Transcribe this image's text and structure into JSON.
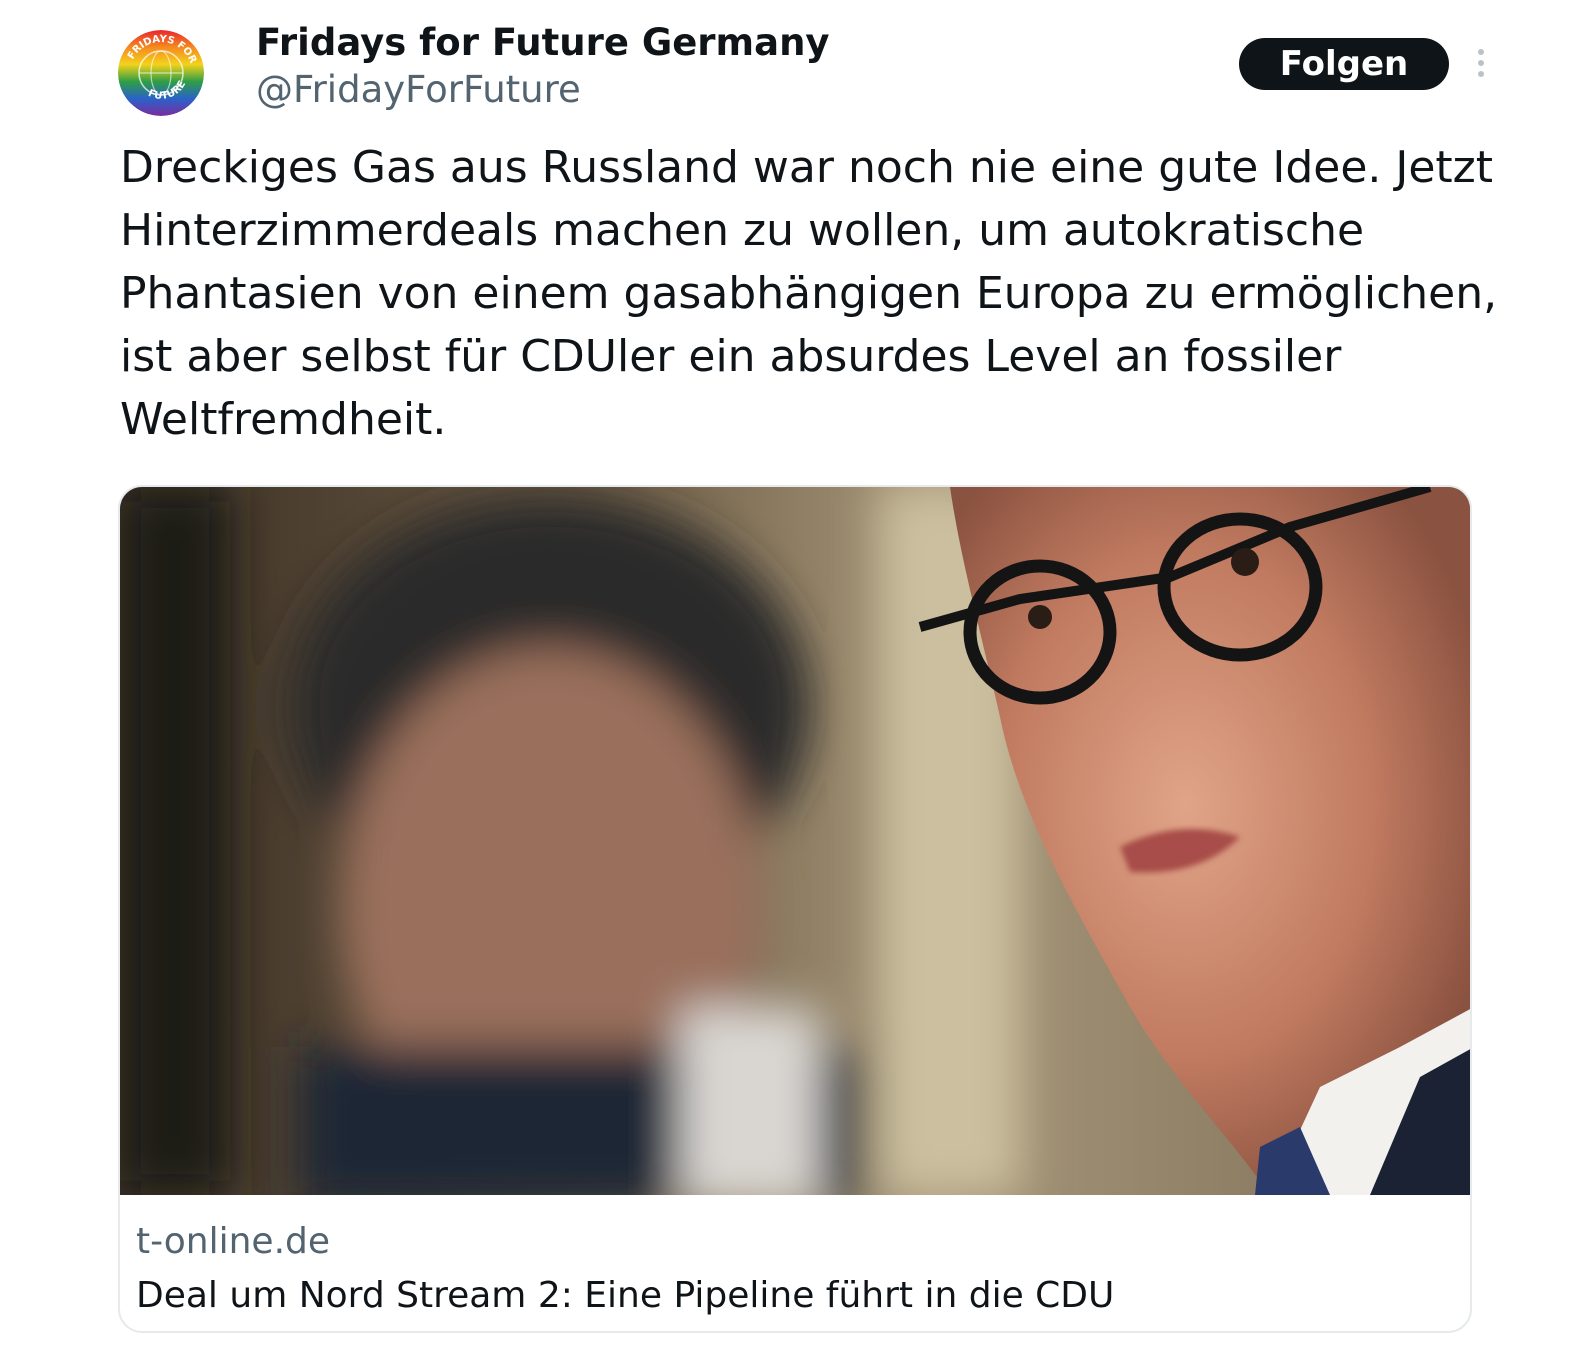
{
  "tweet": {
    "author": {
      "display_name": "Fridays for Future Germany",
      "handle": "@FridayForFuture",
      "avatar_text_top": "FRIDAYS FOR",
      "avatar_text_bottom": "FUTURE",
      "avatar_icon": "rainbow-globe-logo"
    },
    "follow_label": "Folgen",
    "more_icon": "vertical-ellipsis-icon",
    "text": "Dreckiges Gas aus Russland war noch nie eine gute Idee. Jetzt Hinterzimmerdeals machen zu wollen, um autokratische Phantasien von einem gasabhängigen Europa zu ermöglichen, ist aber selbst für CDUler ein absurdes Level an fossiler Weltfremdheit.",
    "card": {
      "domain": "t-online.de",
      "title": "Deal um Nord Stream 2: Eine Pipeline führt in die CDU"
    }
  },
  "colors": {
    "text_primary": "#0f1419",
    "text_secondary": "#536471",
    "follow_bg": "#0f1419",
    "card_border": "#e6eaed"
  }
}
